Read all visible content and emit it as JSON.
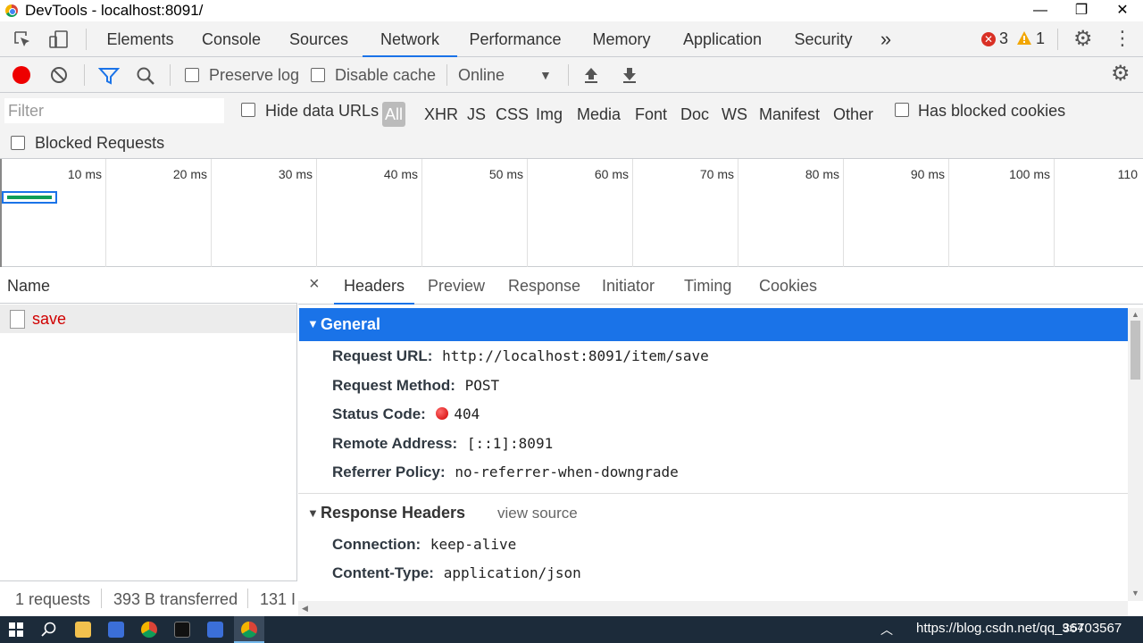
{
  "window": {
    "title": "DevTools - localhost:8091/"
  },
  "main_tabs": [
    "Elements",
    "Console",
    "Sources",
    "Network",
    "Performance",
    "Memory",
    "Application",
    "Security"
  ],
  "more_tabs": "»",
  "errors_count": "3",
  "warnings_count": "1",
  "net_toolbar": {
    "preserve_log": "Preserve log",
    "disable_cache": "Disable cache",
    "throttle": "Online"
  },
  "filter": {
    "placeholder": "Filter",
    "hide_data_urls": "Hide data URLs",
    "types": [
      "All",
      "XHR",
      "JS",
      "CSS",
      "Img",
      "Media",
      "Font",
      "Doc",
      "WS",
      "Manifest",
      "Other"
    ],
    "has_blocked_cookies": "Has blocked cookies",
    "blocked_requests": "Blocked Requests"
  },
  "overview": {
    "ticks": [
      "10 ms",
      "20 ms",
      "30 ms",
      "40 ms",
      "50 ms",
      "60 ms",
      "70 ms",
      "80 ms",
      "90 ms",
      "100 ms",
      "110"
    ]
  },
  "list": {
    "header": "Name",
    "rows": [
      {
        "name": "save"
      }
    ],
    "footer": {
      "requests": "1 requests",
      "transferred": "393 B transferred",
      "resources": "131 I"
    }
  },
  "detail": {
    "close": "×",
    "tabs": [
      "Headers",
      "Preview",
      "Response",
      "Initiator",
      "Timing",
      "Cookies"
    ],
    "general": {
      "title": "General",
      "rows": [
        {
          "key": "Request URL:",
          "value": "http://localhost:8091/item/save"
        },
        {
          "key": "Request Method:",
          "value": "POST"
        },
        {
          "key": "Status Code:",
          "value": "404"
        },
        {
          "key": "Remote Address:",
          "value": "[::1]:8091"
        },
        {
          "key": "Referrer Policy:",
          "value": "no-referrer-when-downgrade"
        }
      ]
    },
    "response_headers": {
      "title": "Response Headers",
      "view_source": "view source",
      "rows": [
        {
          "key": "Connection:",
          "value": "keep-alive"
        },
        {
          "key": "Content-Type:",
          "value": "application/json"
        }
      ]
    }
  },
  "taskbar": {
    "watermark": "https://blog.csdn.net/qq_36703567",
    "clock": "9:54"
  },
  "colors": {
    "accent": "#1a73e8",
    "record": "#ee0000",
    "error_name": "#d00000",
    "general_bg": "#1a73e8"
  }
}
